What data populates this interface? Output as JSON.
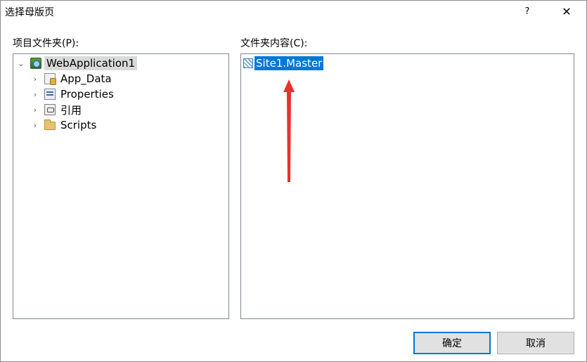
{
  "dialog": {
    "title": "选择母版页",
    "help_label": "?",
    "close_label": "✕"
  },
  "left_panel": {
    "label": "项目文件夹(P):",
    "tree": [
      {
        "label": "WebApplication1",
        "icon": "project-icon",
        "expanded": true,
        "selected": true
      },
      {
        "label": "App_Data",
        "icon": "app-data-folder-icon",
        "expanded": false
      },
      {
        "label": "Properties",
        "icon": "properties-icon",
        "expanded": false
      },
      {
        "label": "引用",
        "icon": "references-icon",
        "expanded": false
      },
      {
        "label": "Scripts",
        "icon": "folder-icon",
        "expanded": false
      }
    ]
  },
  "right_panel": {
    "label": "文件夹内容(C):",
    "files": [
      {
        "label": "Site1.Master",
        "icon": "master-page-icon",
        "selected": true
      }
    ]
  },
  "annotation": {
    "arrow_color": "#e8312e"
  },
  "buttons": {
    "ok_label": "确定",
    "cancel_label": "取消"
  },
  "colors": {
    "selection": "#0078d7",
    "default_button_border": "#0078d7"
  }
}
